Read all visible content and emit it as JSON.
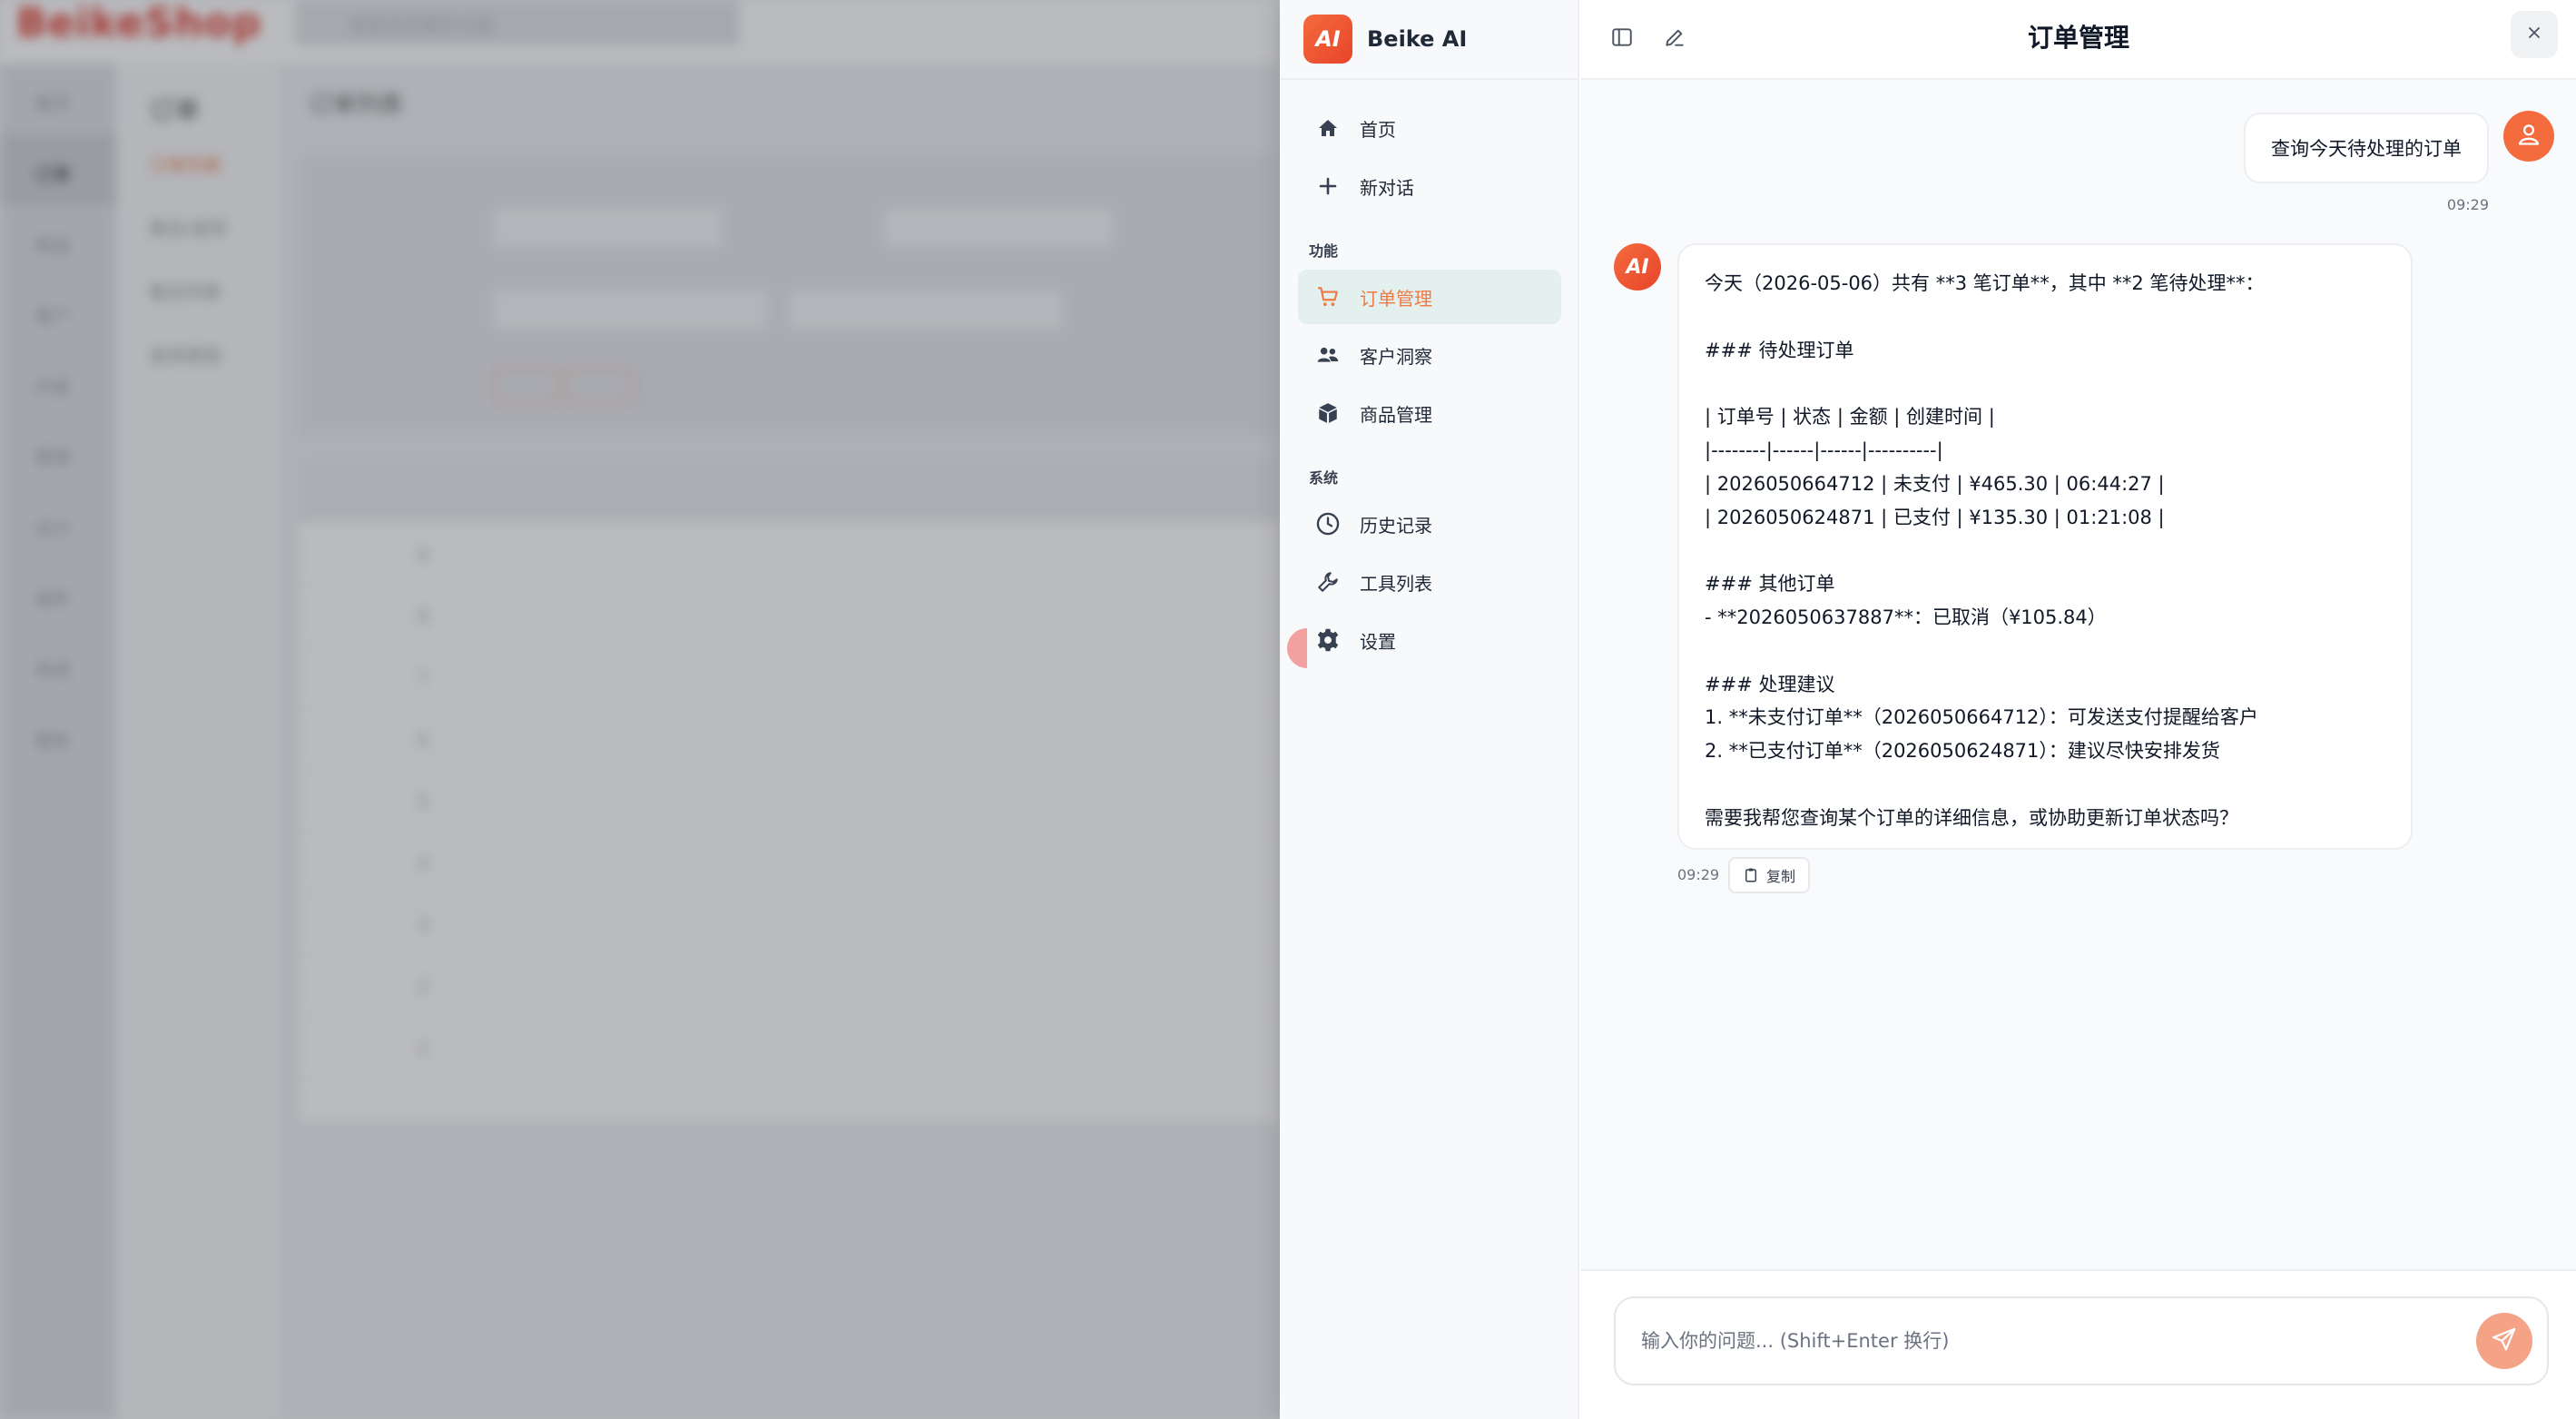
{
  "background": {
    "logo": "BeikeShop",
    "search_placeholder": "搜索您想要的功能",
    "nav": [
      "首页",
      "订单",
      "商品",
      "客户",
      "内容",
      "营销",
      "设计",
      "插件",
      "系统",
      "报告"
    ],
    "sub_title": "订单",
    "sub_items": [
      "订单列表",
      "售后/退货",
      "售后列表",
      "退货原因"
    ],
    "breadcrumb": "订单列表",
    "table_ids": [
      "8",
      "8",
      "7",
      "6",
      "5",
      "4",
      "3",
      "2",
      "1"
    ]
  },
  "app": {
    "name": "Beike AI",
    "logo_text": "AI"
  },
  "sidebar": {
    "top_items": [
      {
        "label": "首页",
        "icon": "home-icon"
      },
      {
        "label": "新对话",
        "icon": "plus-icon"
      }
    ],
    "section_function": "功能",
    "function_items": [
      {
        "label": "订单管理",
        "icon": "cart-icon",
        "active": true
      },
      {
        "label": "客户洞察",
        "icon": "users-icon"
      },
      {
        "label": "商品管理",
        "icon": "box-icon"
      }
    ],
    "section_system": "系统",
    "system_items": [
      {
        "label": "历史记录",
        "icon": "clock-icon"
      },
      {
        "label": "工具列表",
        "icon": "wrench-icon"
      },
      {
        "label": "设置",
        "icon": "gear-icon"
      }
    ]
  },
  "header": {
    "title": "订单管理"
  },
  "messages": {
    "user": {
      "text": "查询今天待处理的订单",
      "time": "09:29"
    },
    "assistant": {
      "lines": [
        "今天（2026-05-06）共有 **3 笔订单**，其中 **2 笔待处理**：",
        "",
        "### 待处理订单",
        "",
        "| 订单号 | 状态 | 金额 | 创建时间 |",
        "|--------|------|------|----------|",
        "| 2026050664712 | 未支付 | ¥465.30 | 06:44:27 |",
        "| 2026050624871 | 已支付 | ¥135.30 | 01:21:08 |",
        "",
        "### 其他订单",
        "- **2026050637887**：已取消（¥105.84）",
        "",
        "### 处理建议",
        "1. **未支付订单**（2026050664712）：可发送支付提醒给客户",
        "2. **已支付订单**（2026050624871）：建议尽快安排发货",
        "",
        "需要我帮您查询某个订单的详细信息，或协助更新订单状态吗？"
      ],
      "time": "09:29",
      "copy_label": "复制"
    }
  },
  "composer": {
    "placeholder": "输入你的问题... (Shift+Enter 换行)"
  },
  "colors": {
    "accent": "#ee7a45",
    "active_bg": "#e3f0ee",
    "send_button": "#f5a386"
  }
}
